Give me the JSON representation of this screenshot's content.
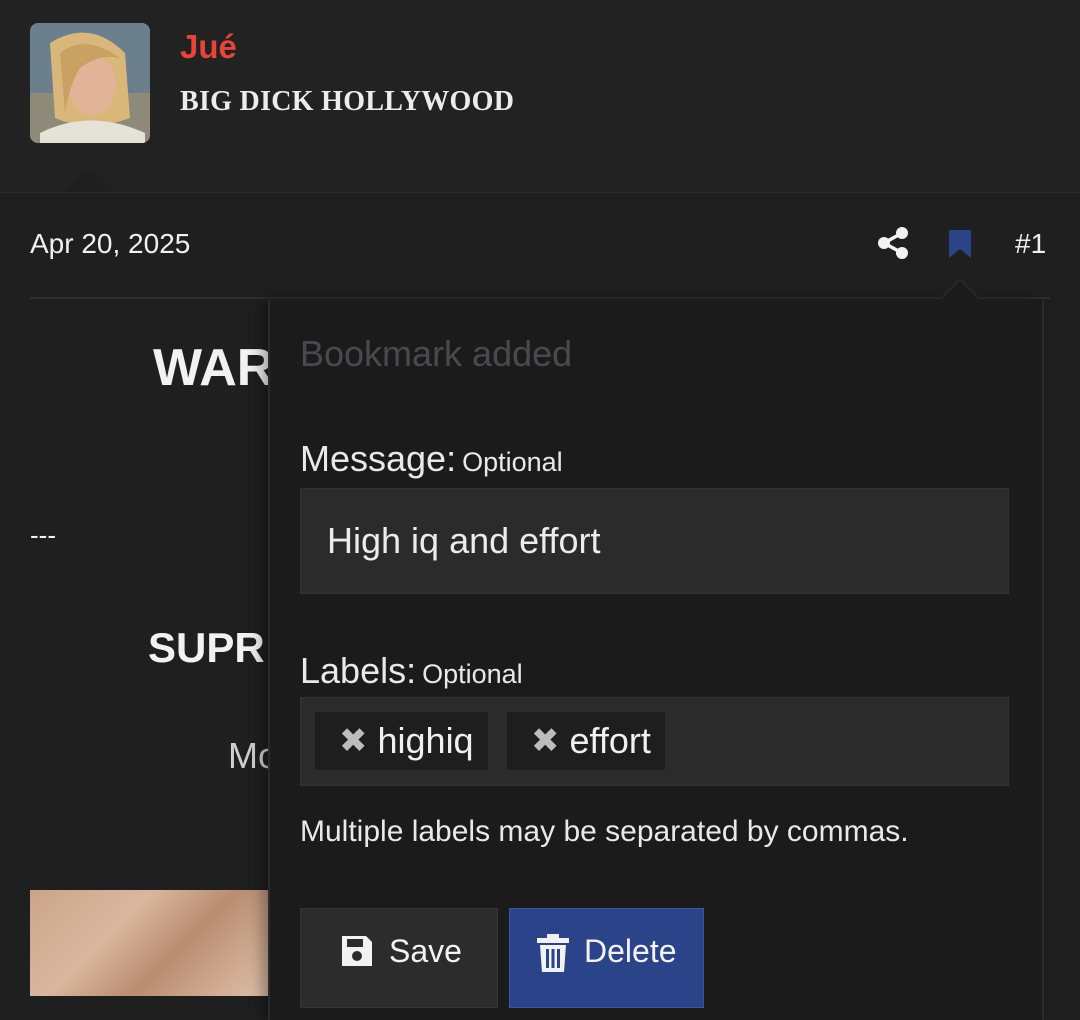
{
  "user": {
    "name": "Jué",
    "title": "BIG DICK HOLLYWOOD"
  },
  "post": {
    "date": "Apr 20, 2025",
    "number": "#1",
    "body": {
      "heading1": "WAR",
      "dashes": "---",
      "heading2": "SUPR",
      "text1": "Mo"
    }
  },
  "popup": {
    "title": "Bookmark added",
    "message_label": "Message:",
    "message_optional": "Optional",
    "message_value": "High iq and effort",
    "labels_label": "Labels:",
    "labels_optional": "Optional",
    "tags": [
      "highiq",
      "effort"
    ],
    "hint": "Multiple labels may be separated by commas.",
    "save_label": "Save",
    "delete_label": "Delete"
  },
  "colors": {
    "username": "#e8443a",
    "bookmark": "#2b4389",
    "delete_button": "#2b4389"
  },
  "icons": [
    "share-icon",
    "bookmark-icon",
    "tag-remove-icon",
    "save-icon",
    "trash-icon"
  ]
}
